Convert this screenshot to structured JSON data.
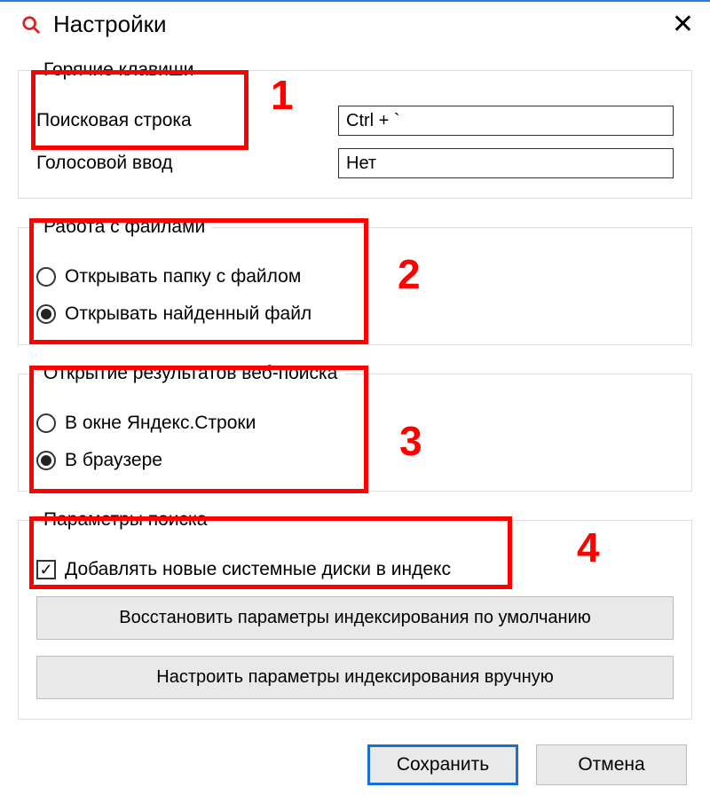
{
  "window": {
    "title": "Настройки"
  },
  "hotkeys": {
    "legend": "Горячие клавиши",
    "search_label": "Поисковая строка",
    "search_value": "Ctrl + `",
    "voice_label": "Голосовой ввод",
    "voice_value": "Нет"
  },
  "files": {
    "legend": "Работа с файлами",
    "open_folder": "Открывать папку с файлом",
    "open_file": "Открывать найденный файл",
    "selected": "open_file"
  },
  "web_results": {
    "legend": "Открытие результатов веб-поиска",
    "in_window": "В окне Яндекс.Строки",
    "in_browser": "В браузере",
    "selected": "in_browser"
  },
  "search_params": {
    "legend": "Параметры поиска",
    "add_disks": "Добавлять новые системные диски в индекс",
    "add_disks_checked": true,
    "restore_defaults": "Восстановить параметры индексирования по умолчанию",
    "configure_manual": "Настроить параметры индексирования вручную"
  },
  "footer": {
    "save": "Сохранить",
    "cancel": "Отмена"
  },
  "annotations": {
    "a1": "1",
    "a2": "2",
    "a3": "3",
    "a4": "4"
  }
}
